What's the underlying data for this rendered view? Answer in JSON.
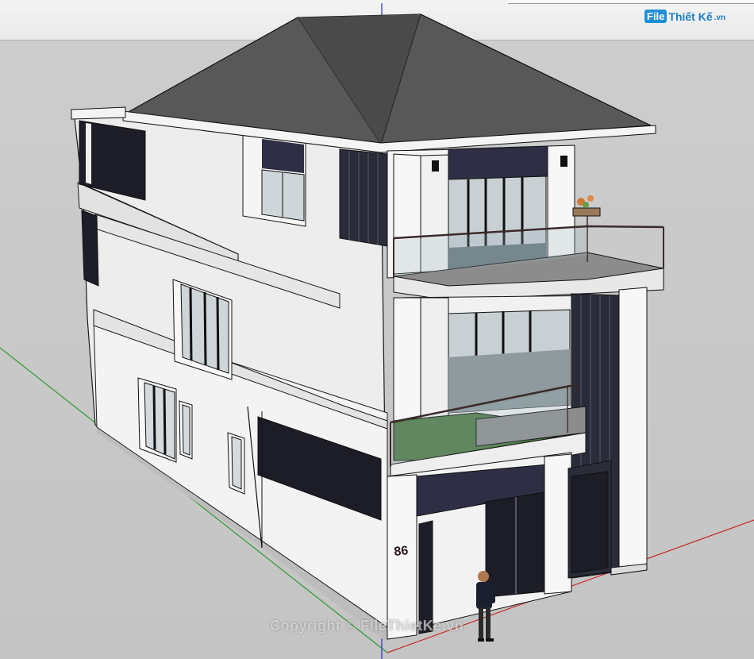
{
  "logo": {
    "mark": "File",
    "name": "Thiết Kế",
    "tld": ".vn"
  },
  "house": {
    "number": "86"
  },
  "watermark": {
    "text": "Copyright © FileThietKe.vn"
  },
  "colors": {
    "background": "#c9c9c9",
    "roof": "#5c5c5c",
    "wall": "#f2f2f2",
    "wall_shade": "#dcdcdc",
    "dark_panel": "#2e2f45",
    "glass": "#8fa0a8",
    "green_axis": "#2e9a2e",
    "red_axis": "#c82a2a",
    "blue_axis": "#2a2ad0",
    "grass": "#4f7a44"
  }
}
